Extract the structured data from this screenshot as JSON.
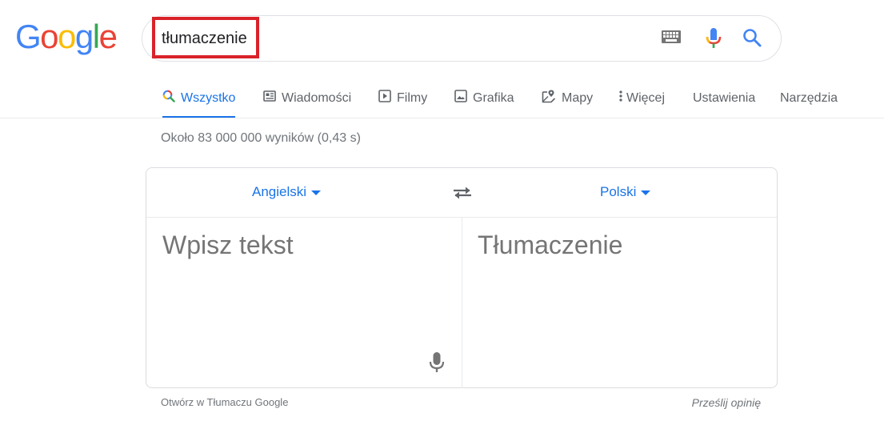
{
  "logo": {
    "letters": [
      "G",
      "o",
      "o",
      "g",
      "l",
      "e"
    ]
  },
  "search": {
    "query": "tłumaczenie",
    "icons": [
      "keyboard-icon",
      "mic-icon",
      "search-icon"
    ]
  },
  "tabs": [
    {
      "label": "Wszystko",
      "icon": "search-icon",
      "active": true
    },
    {
      "label": "Wiadomości",
      "icon": "news-icon"
    },
    {
      "label": "Filmy",
      "icon": "play-icon"
    },
    {
      "label": "Grafika",
      "icon": "image-icon"
    },
    {
      "label": "Mapy",
      "icon": "map-icon"
    },
    {
      "label": "Więcej",
      "icon": "more-vert-icon"
    },
    {
      "label": "Ustawienia"
    },
    {
      "label": "Narzędzia"
    }
  ],
  "result_stats": "Około 83 000 000 wyników (0,43 s)",
  "translator": {
    "source_lang": "Angielski",
    "target_lang": "Polski",
    "source_placeholder": "Wpisz tekst",
    "target_placeholder": "Tłumaczenie"
  },
  "footer": {
    "open_link": "Otwórz w Tłumaczu Google",
    "feedback": "Prześlij opinię"
  },
  "colors": {
    "accent": "#1a73e8",
    "highlight_box": "#d9222a"
  }
}
